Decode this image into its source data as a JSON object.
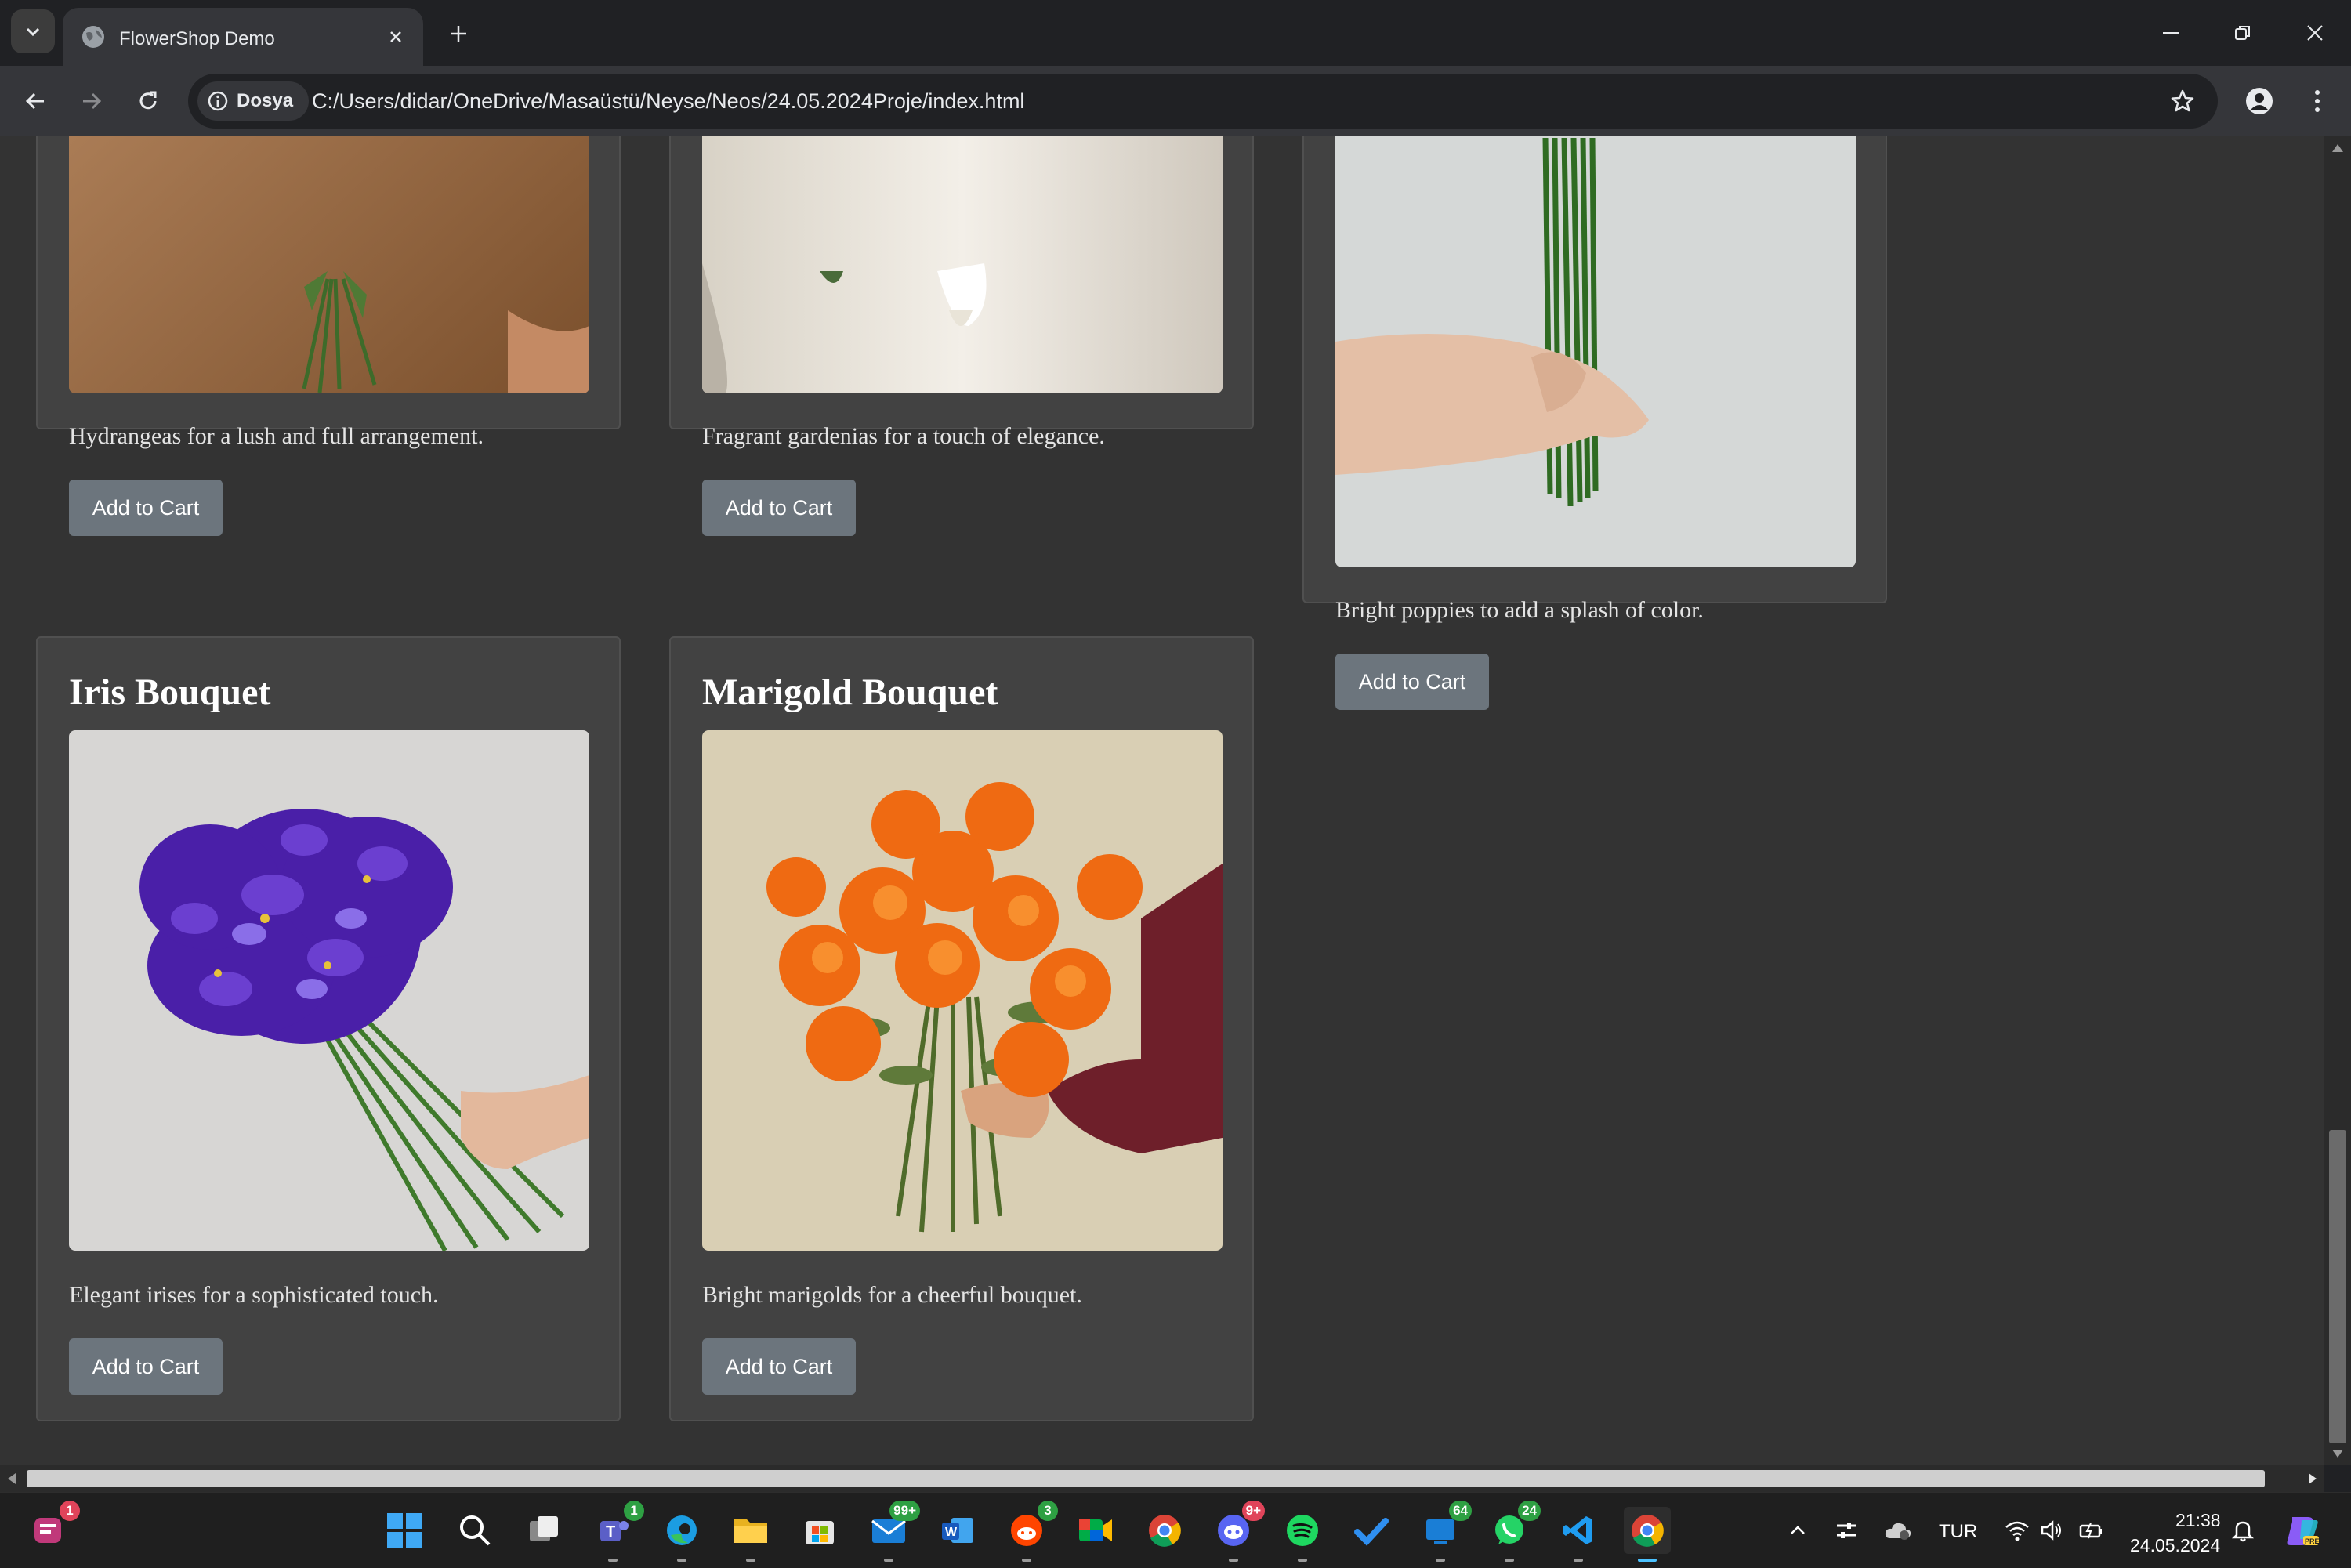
{
  "browser": {
    "tab_title": "FlowerShop Demo",
    "security_chip": "Dosya",
    "url": "C:/Users/didar/OneDrive/Masaüstü/Neyse/Neos/24.05.2024Proje/index.html"
  },
  "products": [
    {
      "description": "Hydrangeas for a lush and full arrangement.",
      "button": "Add to Cart"
    },
    {
      "description": "Fragrant gardenias for a touch of elegance.",
      "button": "Add to Cart"
    },
    {
      "description": "Bright poppies to add a splash of color.",
      "button": "Add to Cart"
    },
    {
      "title": "Iris Bouquet",
      "description": "Elegant irises for a sophisticated touch.",
      "button": "Add to Cart"
    },
    {
      "title": "Marigold Bouquet",
      "description": "Bright marigolds for a cheerful bouquet.",
      "button": "Add to Cart"
    }
  ],
  "taskbar": {
    "badges": {
      "notes": "1",
      "teams": "1",
      "mail": "99+",
      "reddit": "3",
      "discord": "9+",
      "todo": "64",
      "whatsapp": "24"
    },
    "language": "TUR",
    "time": "21:38",
    "date": "24.05.2024"
  }
}
